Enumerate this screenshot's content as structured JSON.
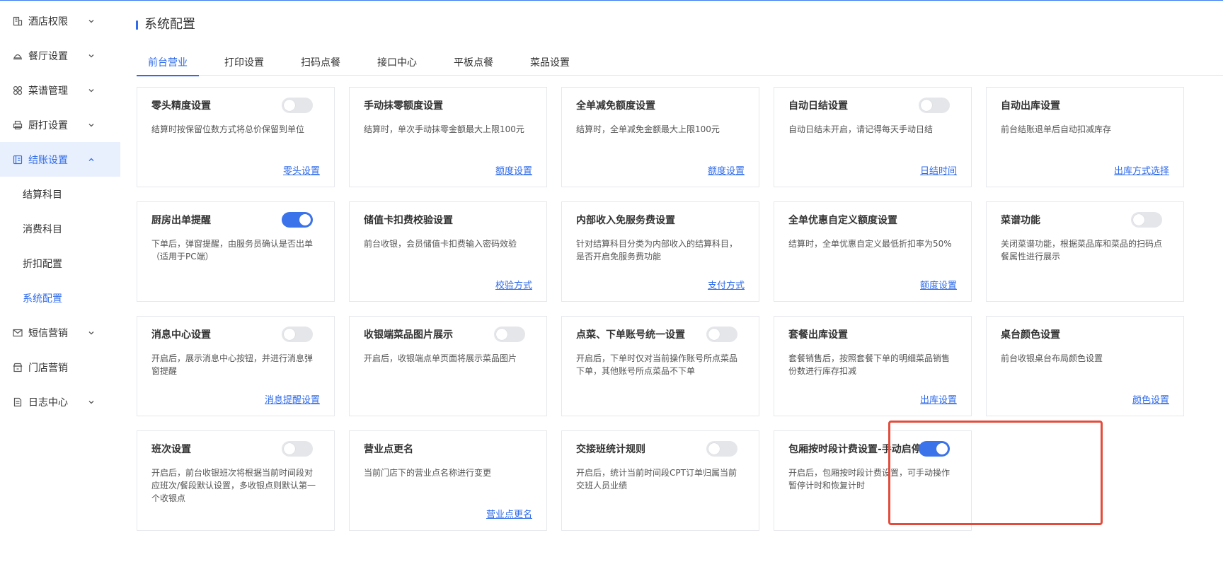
{
  "colors": {
    "accent": "#2f6bea",
    "highlight": "#e34c3c",
    "toggle_on": "#3b73ea",
    "toggle_off": "#e4e6ea"
  },
  "sidebar": {
    "items": [
      {
        "label": "酒店权限",
        "icon": "building-icon",
        "expandable": true,
        "expanded": false
      },
      {
        "label": "餐厅设置",
        "icon": "dish-cover-icon",
        "expandable": true,
        "expanded": false
      },
      {
        "label": "菜谱管理",
        "icon": "grid-icon",
        "expandable": true,
        "expanded": false
      },
      {
        "label": "厨打设置",
        "icon": "printer-icon",
        "expandable": true,
        "expanded": false
      },
      {
        "label": "结账设置",
        "icon": "checkout-icon",
        "expandable": true,
        "expanded": true,
        "active": true,
        "children": [
          {
            "label": "结算科目"
          },
          {
            "label": "消费科目"
          },
          {
            "label": "折扣配置"
          },
          {
            "label": "系统配置",
            "active": true
          }
        ]
      },
      {
        "label": "短信营销",
        "icon": "mail-icon",
        "expandable": true,
        "expanded": false
      },
      {
        "label": "门店营销",
        "icon": "store-icon",
        "expandable": false
      },
      {
        "label": "日志中心",
        "icon": "document-icon",
        "expandable": true,
        "expanded": false
      }
    ]
  },
  "main": {
    "title": "系统配置",
    "tabs": [
      {
        "label": "前台营业",
        "active": true
      },
      {
        "label": "打印设置"
      },
      {
        "label": "扫码点餐"
      },
      {
        "label": "接口中心"
      },
      {
        "label": "平板点餐"
      },
      {
        "label": "菜品设置"
      }
    ],
    "cards": [
      {
        "title": "零头精度设置",
        "toggle": "off",
        "desc": "结算时按保留位数方式将总价保留到单位",
        "link": "零头设置"
      },
      {
        "title": "手动抹零额度设置",
        "desc": "结算时，单次手动抹零金额最大上限100元",
        "link": "额度设置"
      },
      {
        "title": "全单减免额度设置",
        "desc": "结算时，全单减免金额最大上限100元",
        "link": "额度设置"
      },
      {
        "title": "自动日结设置",
        "toggle": "off",
        "desc": "自动日结未开启，请记得每天手动日结",
        "link": "日结时间"
      },
      {
        "title": "自动出库设置",
        "desc": "前台结账退单后自动扣减库存",
        "link": "出库方式选择"
      },
      {
        "title": "厨房出单提醒",
        "toggle": "on",
        "desc": "下单后，弹窗提醒，由服务员确认是否出单（适用于PC端）"
      },
      {
        "title": "储值卡扣费校验设置",
        "desc": "前台收银，会员储值卡扣费输入密码效验",
        "link": "校验方式"
      },
      {
        "title": "内部收入免服务费设置",
        "desc": "针对结算科目分类为内部收入的结算科目，是否开启免服务费功能",
        "link": "支付方式"
      },
      {
        "title": "全单优惠自定义额度设置",
        "desc": "结算时，全单优惠自定义最低折扣率为50%",
        "link": "额度设置"
      },
      {
        "title": "菜谱功能",
        "toggle": "off",
        "desc": "关闭菜谱功能，根据菜品库和菜品的扫码点餐属性进行展示"
      },
      {
        "title": "消息中心设置",
        "toggle": "off",
        "desc": "开启后，展示消息中心按钮，并进行消息弹窗提醒",
        "link": "消息提醒设置"
      },
      {
        "title": "收银端菜品图片展示",
        "toggle": "off",
        "desc": "开启后，收银端点单页面将展示菜品图片"
      },
      {
        "title": "点菜、下单账号统一设置",
        "toggle": "off",
        "desc": "开启后，下单时仅对当前操作账号所点菜品下单，其他账号所点菜品不下单"
      },
      {
        "title": "套餐出库设置",
        "desc": "套餐销售后，按照套餐下单的明细菜品销售份数进行库存扣减",
        "link": "出库设置"
      },
      {
        "title": "桌台颜色设置",
        "desc": "前台收银桌台布局颜色设置",
        "link": "颜色设置"
      },
      {
        "title": "班次设置",
        "toggle": "off",
        "desc": "开启后，前台收银班次将根据当前时间段对应班次/餐段默认设置，多收银点则默认第一个收银点"
      },
      {
        "title": "营业点更名",
        "desc": "当前门店下的营业点名称进行变更",
        "link": "营业点更名"
      },
      {
        "title": "交接班统计规则",
        "toggle": "off",
        "desc": "开启后，统计当前时间段CPT订单归属当前交班人员业绩"
      },
      {
        "title": "包厢按时段计费设置-手动启停",
        "toggle": "on",
        "desc": "开启后，包厢按时段计费设置，可手动操作暂停计时和恢复计时",
        "highlighted": true
      }
    ]
  }
}
